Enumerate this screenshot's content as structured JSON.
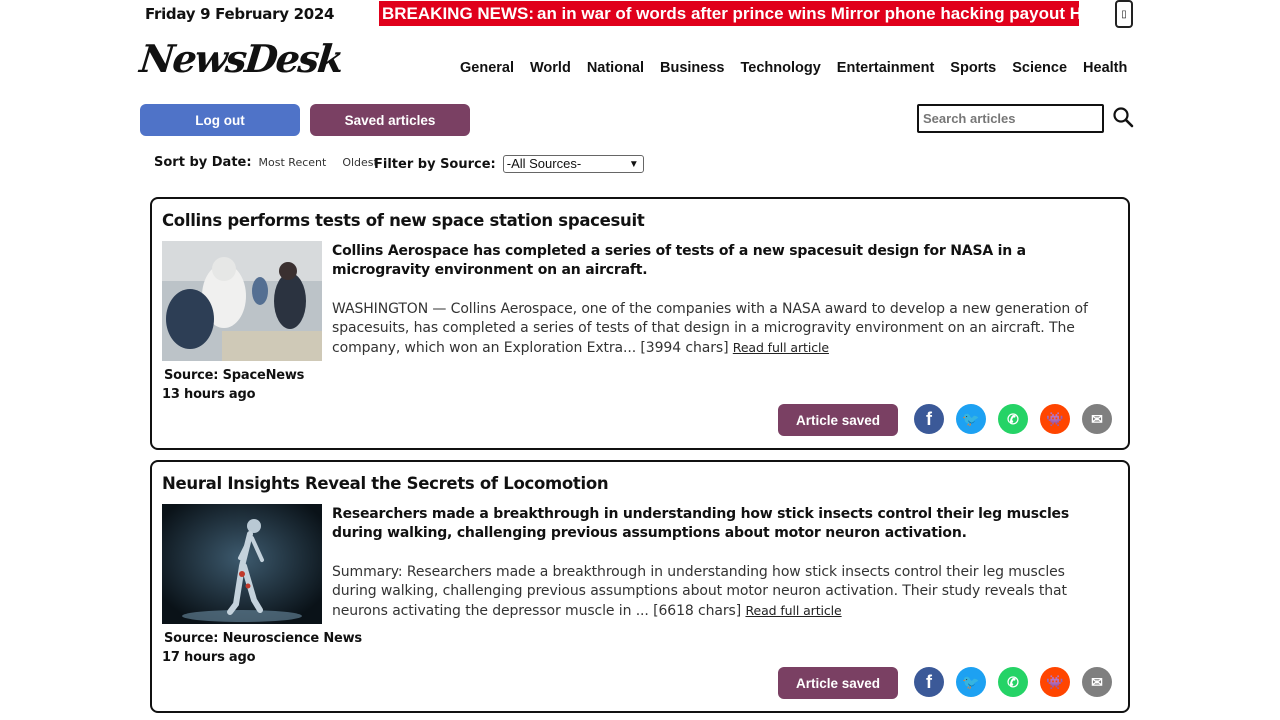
{
  "header": {
    "date": "Friday 9 February 2024",
    "breaking_label": "BREAKING NEWS:",
    "breaking_text": "an in war of words after prince wins Mirror phone hacking payout     Ha",
    "logo": "NewsDesk"
  },
  "nav": [
    "General",
    "World",
    "National",
    "Business",
    "Technology",
    "Entertainment",
    "Sports",
    "Science",
    "Health"
  ],
  "actions": {
    "logout": "Log out",
    "saved_articles": "Saved articles",
    "search_placeholder": "Search articles"
  },
  "filters": {
    "sort_label": "Sort by Date:",
    "sort_options": [
      "Most Recent",
      "Oldest"
    ],
    "source_label": "Filter by Source:",
    "source_selected": "-All Sources-"
  },
  "articles": [
    {
      "title": "Collins performs tests of new space station spacesuit",
      "lead": "Collins Aerospace has completed a series of tests of a new spacesuit design for NASA in a microgravity environment on an aircraft.",
      "body": "WASHINGTON — Collins Aerospace, one of the companies with a NASA award to develop a new generation of spacesuits, has completed a series of tests of that design in a microgravity environment on an aircraft. The company, which won an Exploration Extra... [3994 chars]",
      "read_more": "Read full article",
      "source": "Source: SpaceNews",
      "ago": "13 hours ago",
      "saved_label": "Article saved"
    },
    {
      "title": "Neural Insights Reveal the Secrets of Locomotion",
      "lead": "Researchers made a breakthrough in understanding how stick insects control their leg muscles during walking, challenging previous assumptions about motor neuron activation.",
      "body": "Summary: Researchers made a breakthrough in understanding how stick insects control their leg muscles during walking, challenging previous assumptions about motor neuron activation. Their study reveals that neurons activating the depressor muscle in ... [6618 chars]",
      "read_more": "Read full article",
      "source": "Source: Neuroscience News",
      "ago": "17 hours ago",
      "saved_label": "Article saved"
    }
  ],
  "colors": {
    "breaking": "#e0001b",
    "logout": "#4f73c8",
    "saved": "#7a4063"
  }
}
